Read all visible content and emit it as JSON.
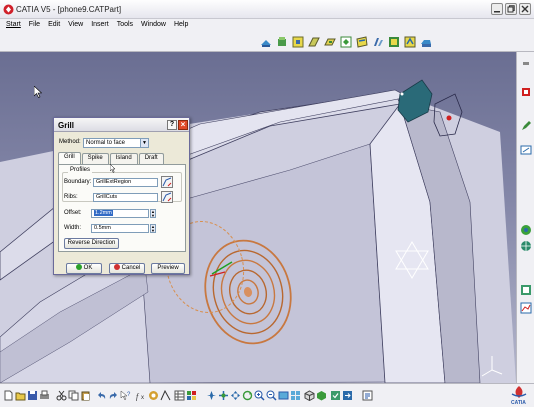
{
  "window": {
    "title": "CATIA V5 - [phone9.CATPart]"
  },
  "menu": {
    "items": [
      "Start",
      "File",
      "Edit",
      "View",
      "Insert",
      "Tools",
      "Window",
      "Help"
    ]
  },
  "dialog": {
    "title": "Grill",
    "help_label": "?",
    "close_label": "×",
    "method_label": "Method:",
    "method_value": "Normal to face",
    "tabs": [
      "Grill",
      "Spike",
      "Island",
      "Draft"
    ],
    "active_tab": "Grill",
    "profiles_label": "Profiles",
    "boundary_label": "Boundary:",
    "boundary_value": "GrillExtRegion",
    "ribs_label": "Ribs:",
    "ribs_value": "GrillCuts",
    "offset_label": "Offset:",
    "offset_value": "1.2mm",
    "width_label": "Width:",
    "width_value": "0.5mm",
    "reverse_direction_label": "Reverse Direction",
    "ok_label": "OK",
    "cancel_label": "Cancel",
    "preview_label": "Preview"
  },
  "compass": {
    "logo_text": "CATIA"
  },
  "colors": {
    "viewport_top": "#6a6e92",
    "viewport_bottom": "#b4b6cc",
    "part_surface": "#d8d8e8",
    "grill_orange": "#c87840",
    "ok_green": "#2aa02a",
    "cancel_red": "#d03030"
  }
}
